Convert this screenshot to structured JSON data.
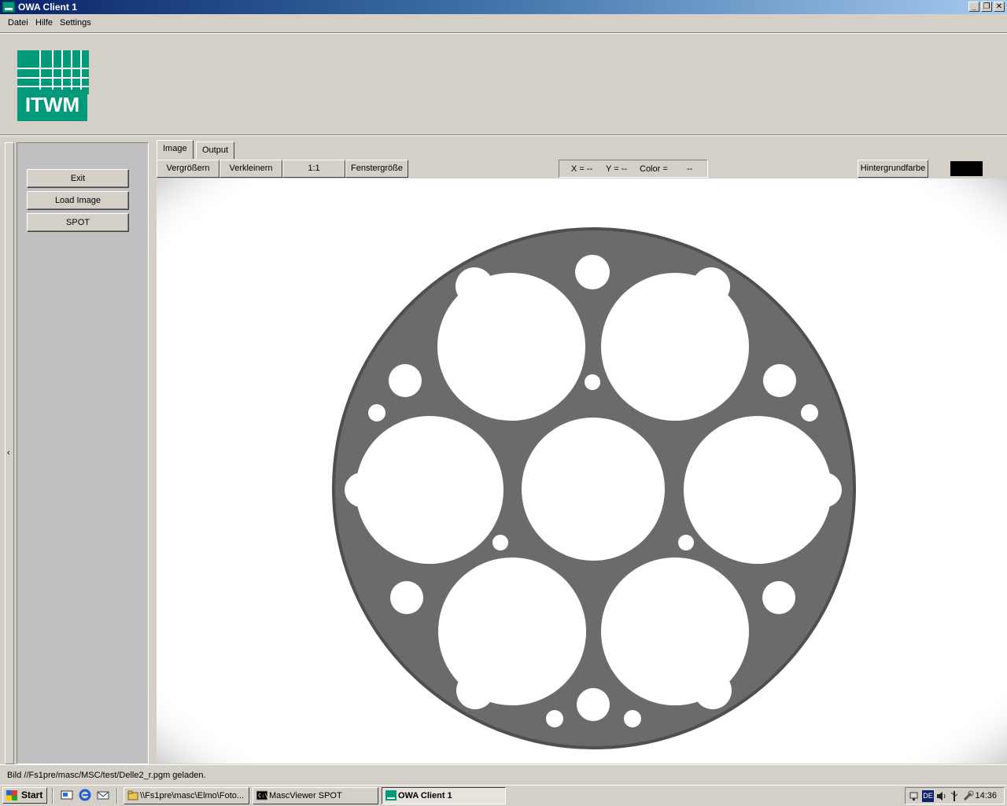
{
  "window": {
    "title": "OWA Client 1",
    "icon": "itwm-app-icon",
    "controls": {
      "minimize": "_",
      "restore": "❐",
      "close": "✕"
    }
  },
  "menu": {
    "items": [
      {
        "label": "Datei"
      },
      {
        "label": "Hilfe"
      },
      {
        "label": "Settings"
      }
    ]
  },
  "logo": {
    "text": "ITWM",
    "color": "#00997a"
  },
  "sidebar": {
    "collapse_glyph": "‹",
    "buttons": [
      {
        "label": "Exit"
      },
      {
        "label": "Load Image"
      },
      {
        "label": "SPOT"
      }
    ]
  },
  "tabs": [
    {
      "label": "Image",
      "active": true
    },
    {
      "label": "Output",
      "active": false
    }
  ],
  "image_toolbar": {
    "zoom_in": "Vergrößern",
    "zoom_out": "Verkleinern",
    "actual_size": "1:1",
    "fit_window": "Fenstergröße",
    "x_readout": "X = --",
    "y_readout": "Y = --",
    "color_label": "Color =",
    "color_value": "--",
    "background_color_button": "Hintergrundfarbe",
    "background_color": "#000000"
  },
  "status": {
    "message": "Bild //Fs1pre/masc/MSC/test/Delle2_r.pgm geladen."
  },
  "taskbar": {
    "start_label": "Start",
    "quick_launch": [
      "show-desktop-icon",
      "internet-explorer-icon",
      "outlook-express-icon"
    ],
    "tasks": [
      {
        "label": "\\\\Fs1pre\\masc\\Elmo\\Foto...",
        "icon": "folder-icon",
        "active": false
      },
      {
        "label": "MascViewer SPOT",
        "icon": "console-icon",
        "active": false
      },
      {
        "label": "OWA Client 1",
        "icon": "itwm-app-icon",
        "active": true
      }
    ],
    "tray": {
      "language": "DE",
      "clock": "14:36"
    }
  }
}
